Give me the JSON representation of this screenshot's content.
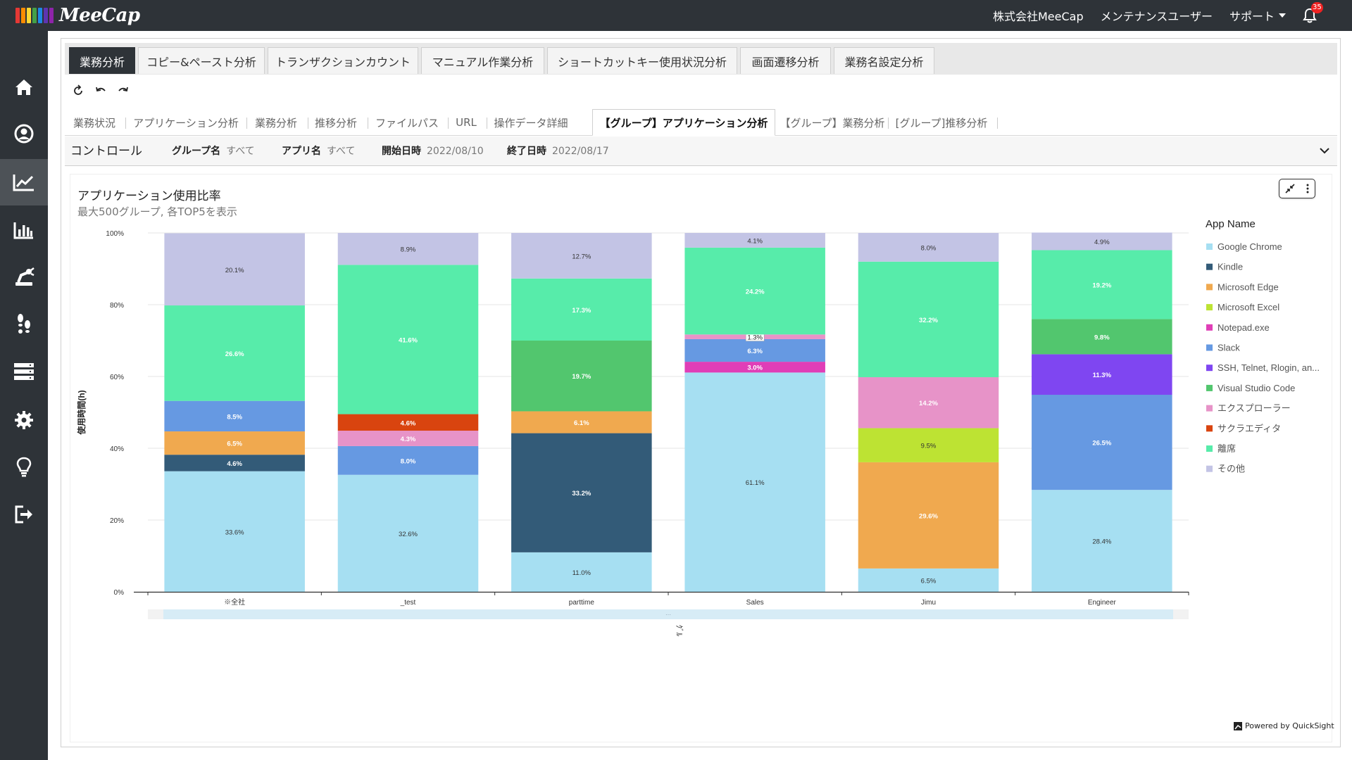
{
  "app": {
    "logo_text": "MeeCap",
    "logo_colors": [
      "#e53935",
      "#fb8c00",
      "#fdd835",
      "#43a047",
      "#1e88e5",
      "#5e35b1",
      "#8e24aa"
    ]
  },
  "header": {
    "company": "株式会社MeeCap",
    "user": "メンテナンスユーザー",
    "support": "サポート",
    "notification_count": "35"
  },
  "sidebar": {
    "items": [
      {
        "icon": "home-icon"
      },
      {
        "icon": "user-icon"
      },
      {
        "icon": "line-chart-icon",
        "active": true
      },
      {
        "icon": "bar-chart-icon"
      },
      {
        "icon": "robot-arm-icon"
      },
      {
        "icon": "footsteps-icon"
      },
      {
        "icon": "server-icon"
      },
      {
        "icon": "gear-icon"
      },
      {
        "icon": "lightbulb-icon"
      },
      {
        "icon": "logout-icon"
      }
    ]
  },
  "tabs": [
    "業務分析",
    "コピー&ペースト分析",
    "トランザクションカウント",
    "マニュアル作業分析",
    "ショートカットキー使用状況分析",
    "画面遷移分析",
    "業務名設定分析"
  ],
  "subtabs": [
    "業務状況",
    "アプリケーション分析",
    "業務分析",
    "推移分析",
    "ファイルパス",
    "URL",
    "操作データ詳細",
    "【グループ】アプリケーション分析",
    "【グループ】業務分析",
    "[グループ]推移分析"
  ],
  "controls": {
    "title": "コントロール",
    "group_label": "グループ名",
    "group_value": "すべて",
    "app_label": "アプリ名",
    "app_value": "すべて",
    "start_label": "開始日時",
    "start_value": "2022/08/10",
    "end_label": "終了日時",
    "end_value": "2022/08/17"
  },
  "visual": {
    "title": "アプリケーション使用比率",
    "subtitle": "最大500グループ, 各TOP5を表示",
    "powered_by": "Powered by QuickSight"
  },
  "chart_data": {
    "type": "bar",
    "stacked": true,
    "percent": true,
    "ylabel": "使用時間(h)",
    "xlabel": "ｸﾞﾙ",
    "ylim": [
      0,
      100
    ],
    "yticks": [
      "0%",
      "20%",
      "40%",
      "60%",
      "80%",
      "100%"
    ],
    "legend_title": "App Name",
    "legend_position": "right",
    "categories": [
      "※全社",
      "_test",
      "parttime",
      "Sales",
      "Jimu",
      "Engineer"
    ],
    "apps": [
      {
        "name": "Google Chrome",
        "color": "#a6dff2"
      },
      {
        "name": "Kindle",
        "color": "#335b78"
      },
      {
        "name": "Microsoft Edge",
        "color": "#f0a94f"
      },
      {
        "name": "Microsoft Excel",
        "color": "#bde333"
      },
      {
        "name": "Notepad.exe",
        "color": "#e03eb7"
      },
      {
        "name": "Slack",
        "color": "#6699e2"
      },
      {
        "name": "SSH, Telnet, Rlogin, an...",
        "color": "#7f46f1"
      },
      {
        "name": "Visual Studio Code",
        "color": "#52c66e"
      },
      {
        "name": "エクスプローラー",
        "color": "#e793c8"
      },
      {
        "name": "サクラエディタ",
        "color": "#d9440f"
      },
      {
        "name": "離席",
        "color": "#57ecaa"
      },
      {
        "name": "その他",
        "color": "#c3c4e5"
      }
    ],
    "stacks": [
      [
        {
          "app": "Google Chrome",
          "value": 33.6
        },
        {
          "app": "Kindle",
          "value": 4.6
        },
        {
          "app": "Microsoft Edge",
          "value": 6.5
        },
        {
          "app": "Slack",
          "value": 8.5
        },
        {
          "app": "離席",
          "value": 26.6
        },
        {
          "app": "その他",
          "value": 20.1
        }
      ],
      [
        {
          "app": "Google Chrome",
          "value": 32.6
        },
        {
          "app": "Slack",
          "value": 8.0
        },
        {
          "app": "エクスプローラー",
          "value": 4.3
        },
        {
          "app": "サクラエディタ",
          "value": 4.6
        },
        {
          "app": "離席",
          "value": 41.6
        },
        {
          "app": "その他",
          "value": 8.9
        }
      ],
      [
        {
          "app": "Google Chrome",
          "value": 11.0
        },
        {
          "app": "Kindle",
          "value": 33.2
        },
        {
          "app": "Microsoft Edge",
          "value": 6.1
        },
        {
          "app": "Visual Studio Code",
          "value": 19.7
        },
        {
          "app": "離席",
          "value": 17.3
        },
        {
          "app": "その他",
          "value": 12.7
        }
      ],
      [
        {
          "app": "Google Chrome",
          "value": 61.1
        },
        {
          "app": "Notepad.exe",
          "value": 3.0
        },
        {
          "app": "Slack",
          "value": 6.3
        },
        {
          "app": "エクスプローラー",
          "value": 1.3
        },
        {
          "app": "離席",
          "value": 24.2
        },
        {
          "app": "その他",
          "value": 4.1
        }
      ],
      [
        {
          "app": "Google Chrome",
          "value": 6.5
        },
        {
          "app": "Microsoft Edge",
          "value": 29.6
        },
        {
          "app": "Microsoft Excel",
          "value": 9.5
        },
        {
          "app": "エクスプローラー",
          "value": 14.2
        },
        {
          "app": "離席",
          "value": 32.2
        },
        {
          "app": "その他",
          "value": 8.0
        }
      ],
      [
        {
          "app": "Google Chrome",
          "value": 28.4
        },
        {
          "app": "Slack",
          "value": 26.5
        },
        {
          "app": "SSH, Telnet, Rlogin, an...",
          "value": 11.3
        },
        {
          "app": "Visual Studio Code",
          "value": 9.8
        },
        {
          "app": "離席",
          "value": 19.2
        },
        {
          "app": "その他",
          "value": 4.9
        }
      ]
    ]
  }
}
